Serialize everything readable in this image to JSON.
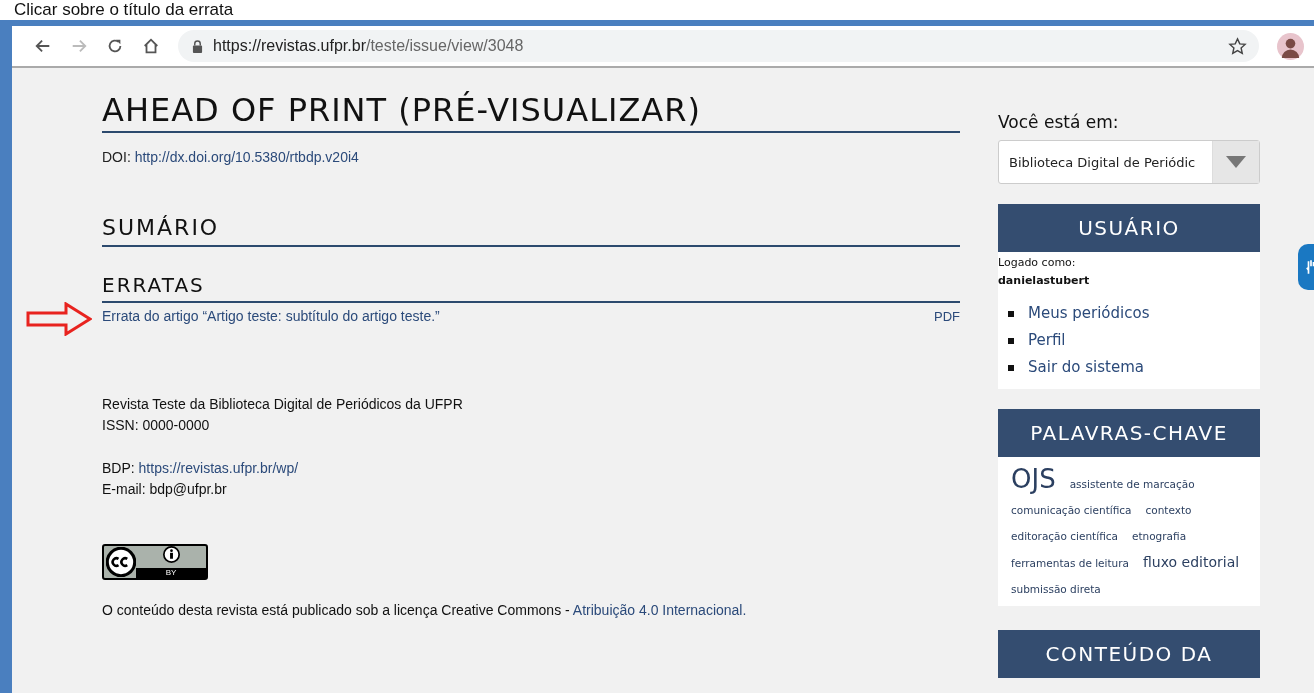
{
  "caption": "Clicar sobre o título da errata",
  "browser": {
    "url_host": "https://revistas.ufpr.br",
    "url_path": "/teste/issue/view/3048"
  },
  "main": {
    "title": "AHEAD OF PRINT (PRÉ-VISUALIZAR)",
    "doi_label": "DOI: ",
    "doi_link": "http://dx.doi.org/10.5380/rtbdp.v20i4",
    "section_title": "SUMÁRIO",
    "subsection_title": "ERRATAS",
    "errata": {
      "title": "Errata do artigo “Artigo teste: subtítulo do artigo teste.”",
      "galley": "PDF"
    },
    "footer": {
      "journal": "Revista Teste da Biblioteca Digital de Periódicos da UFPR",
      "issn": "ISSN: 0000-0000",
      "bdp_label": "BDP: ",
      "bdp_link": "https://revistas.ufpr.br/wp/",
      "email": "E-mail: bdp@ufpr.br",
      "license_badge": "BY",
      "license_text": "O conteúdo desta revista está publicado sob a licença Creative Commons - ",
      "license_link": "Atribuição 4.0 Internacional."
    }
  },
  "sidebar": {
    "location_label": "Você está em:",
    "location_select": "Biblioteca Digital de Periódic",
    "user": {
      "title": "USUÁRIO",
      "logged_as": "Logado como:",
      "username": "danielastubert",
      "links": [
        "Meus periódicos",
        "Perfil",
        "Sair do sistema"
      ]
    },
    "keywords": {
      "title": "PALAVRAS-CHAVE",
      "items": [
        {
          "text": "OJS",
          "kind": "large"
        },
        {
          "text": "assistente de marcação",
          "kind": "small"
        },
        {
          "text": "comunicação científica",
          "kind": "small"
        },
        {
          "text": "contexto",
          "kind": "small"
        },
        {
          "text": "editoração científica",
          "kind": "small"
        },
        {
          "text": "etnografia",
          "kind": "small"
        },
        {
          "text": "ferramentas de leitura",
          "kind": "small"
        },
        {
          "text": "fluxo editorial",
          "kind": "medium"
        },
        {
          "text": "submissão direta",
          "kind": "small"
        }
      ]
    },
    "content_title": "CONTEÚDO DA"
  }
}
